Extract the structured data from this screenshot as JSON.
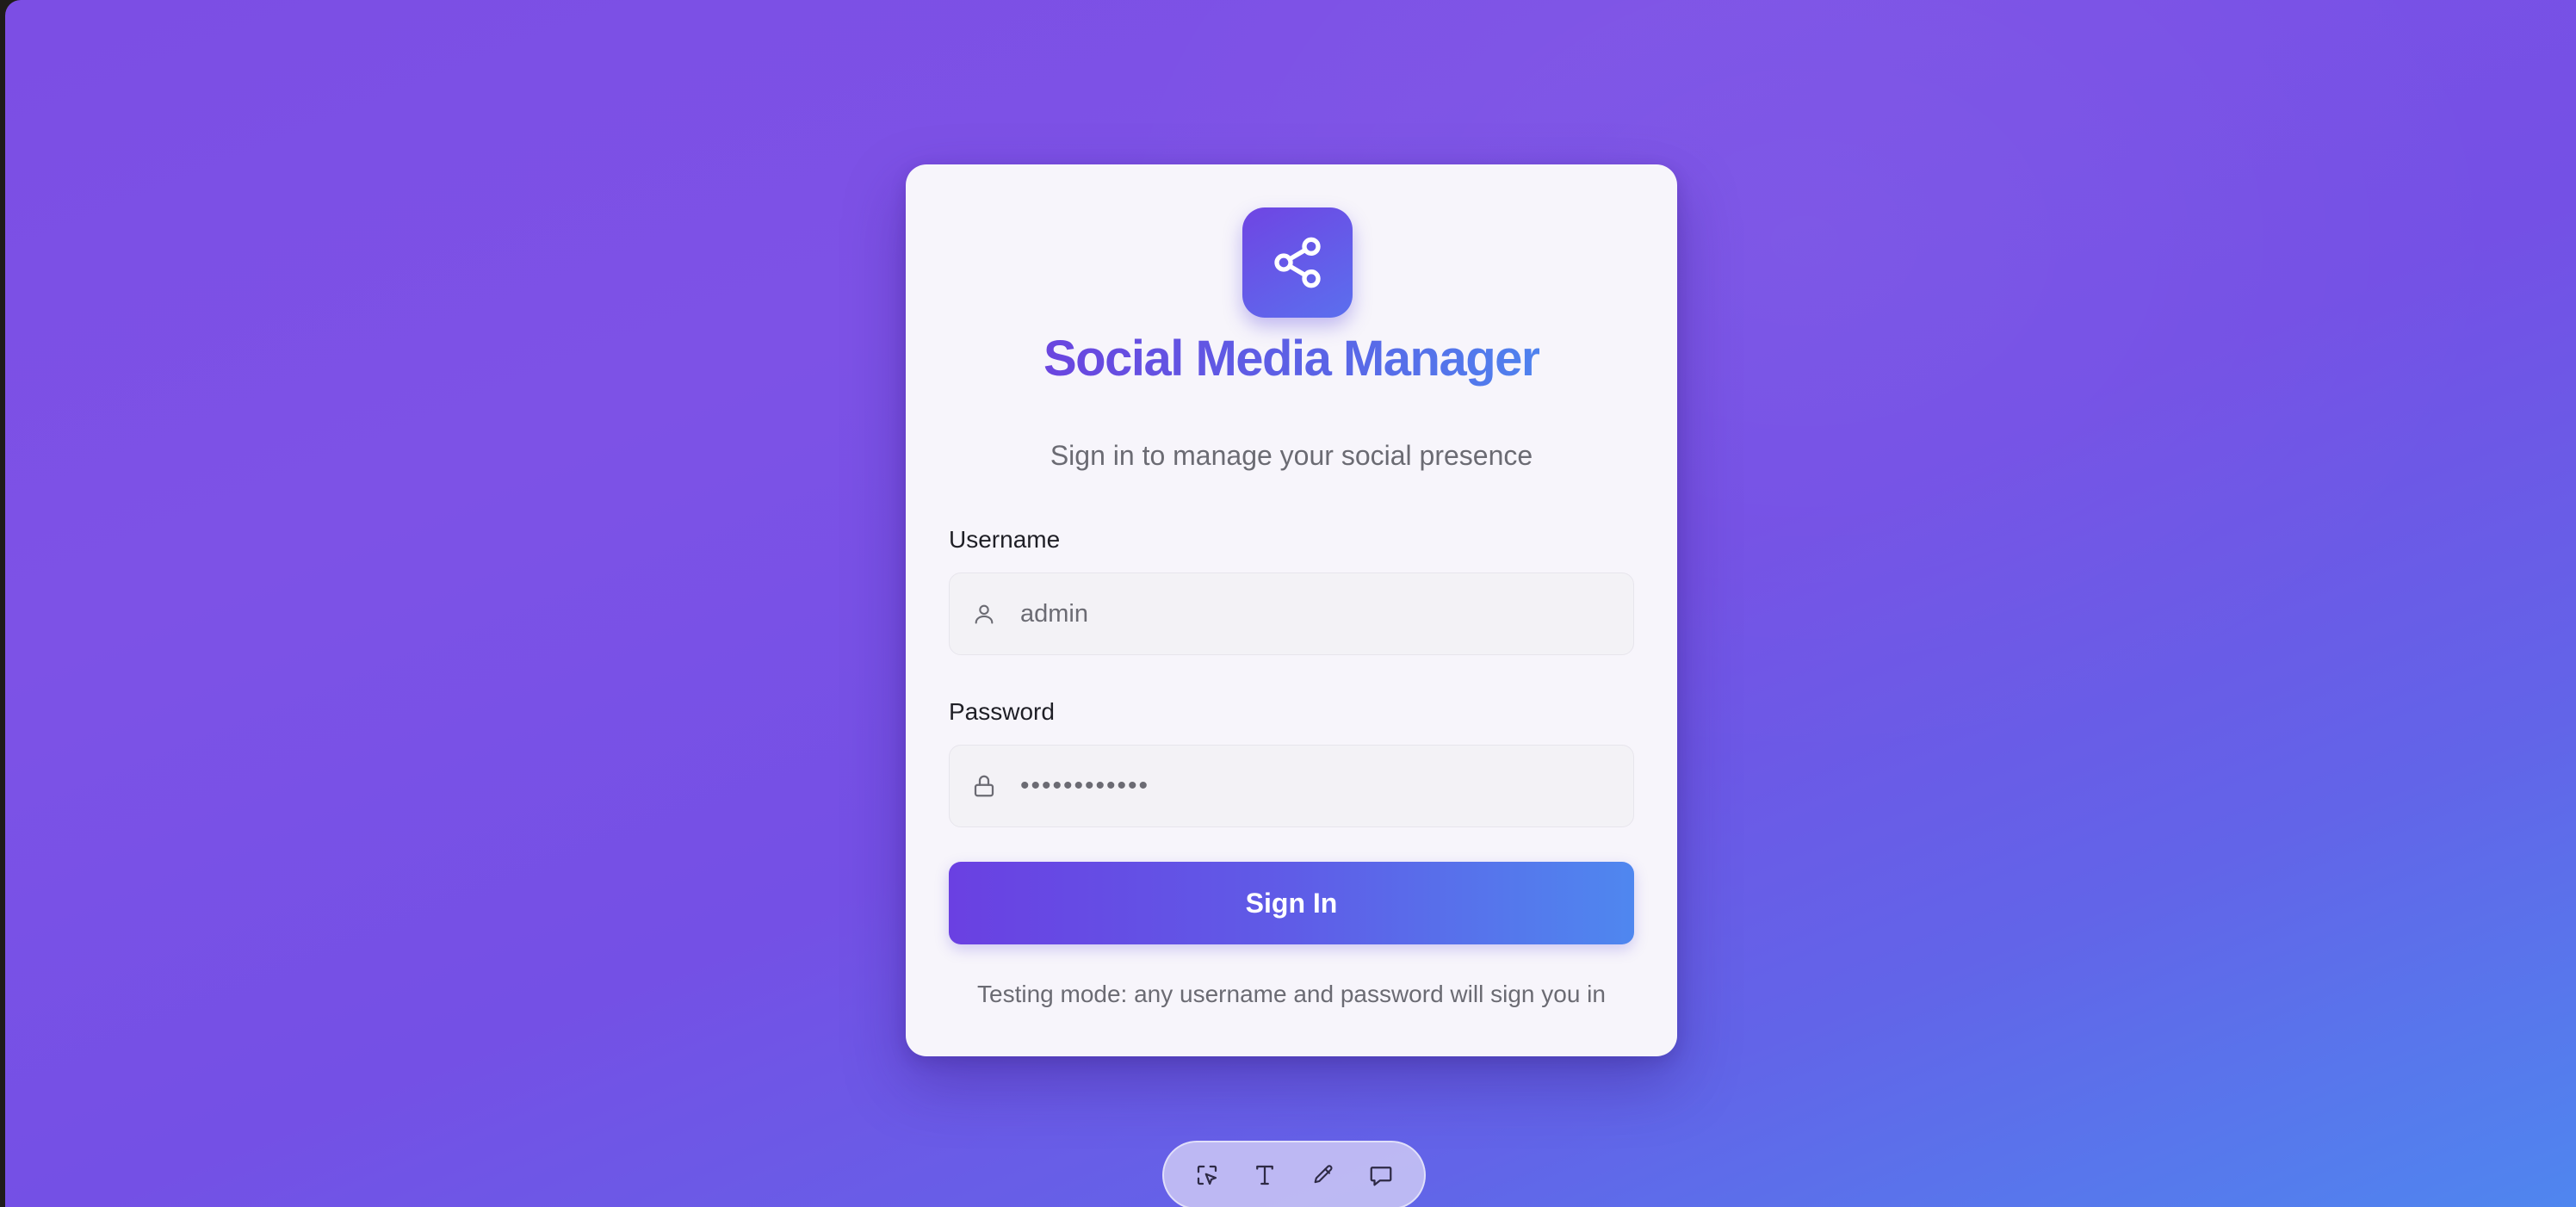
{
  "app": {
    "title": "Social Media Manager",
    "subtitle": "Sign in to manage your social presence"
  },
  "form": {
    "username_label": "Username",
    "username_value": "admin",
    "password_label": "Password",
    "password_value": "••••••••••••",
    "submit_label": "Sign In",
    "hint": "Testing mode: any username and password will sign you in"
  },
  "icons": {
    "logo": "share-icon",
    "username": "user-icon",
    "password": "lock-icon"
  },
  "toolbar": {
    "tools": [
      "select-element-icon",
      "text-icon",
      "pencil-icon",
      "comment-icon"
    ]
  },
  "colors": {
    "brand_start": "#6a40e2",
    "brand_end": "#4f87ef"
  }
}
